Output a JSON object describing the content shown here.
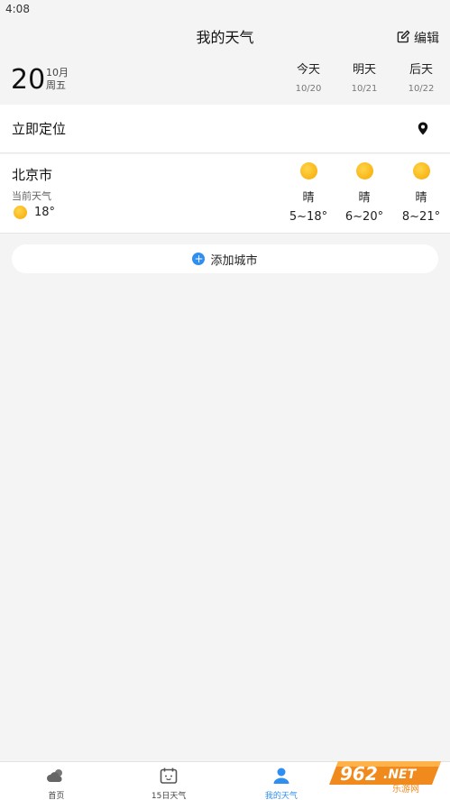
{
  "status_bar": {
    "time": "4:08"
  },
  "header": {
    "title": "我的天气",
    "edit_label": "编辑"
  },
  "date": {
    "day": "20",
    "month": "10月",
    "weekday": "周五"
  },
  "days": [
    {
      "name": "今天",
      "date": "10/20"
    },
    {
      "name": "明天",
      "date": "10/21"
    },
    {
      "name": "后天",
      "date": "10/22"
    }
  ],
  "locate": {
    "label": "立即定位"
  },
  "city": {
    "name": "北京市",
    "current_label": "当前天气",
    "current_temp": "18°",
    "forecast": [
      {
        "condition": "晴",
        "range": "5~18°",
        "icon": "sun-icon"
      },
      {
        "condition": "晴",
        "range": "6~20°",
        "icon": "sun-icon"
      },
      {
        "condition": "晴",
        "range": "8~21°",
        "icon": "sun-icon"
      }
    ]
  },
  "add_city": {
    "label": "添加城市"
  },
  "nav": {
    "items": [
      {
        "label": "首页",
        "icon": "cloud-sun-icon"
      },
      {
        "label": "15日天气",
        "icon": "calendar-icon"
      },
      {
        "label": "我的天气",
        "icon": "user-icon"
      }
    ]
  },
  "watermark": {
    "text": "962.NET",
    "subtext": "乐游网"
  },
  "colors": {
    "accent": "#2f8ff0",
    "sun": "#f7a700",
    "background": "#f4f4f4"
  }
}
